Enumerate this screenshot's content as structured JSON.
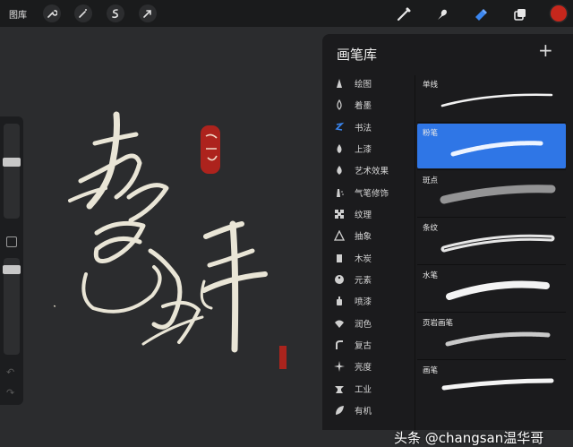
{
  "topbar": {
    "gallery_label": "图库",
    "left_tools": [
      {
        "icon": "wrench-icon"
      },
      {
        "icon": "magic-wand-icon"
      },
      {
        "icon": "selection-icon"
      },
      {
        "icon": "transform-arrow-icon"
      }
    ],
    "right_tools": [
      {
        "icon": "brush-icon",
        "active": false
      },
      {
        "icon": "smudge-icon",
        "active": false
      },
      {
        "icon": "eraser-icon",
        "active": true
      },
      {
        "icon": "layers-icon",
        "active": false
      }
    ],
    "current_color": "#c6271c",
    "accent_color": "#2f76e6"
  },
  "brush_library": {
    "title": "画笔库",
    "add_label": "+",
    "categories": [
      {
        "label": "绘图",
        "icon": "pencil-icon"
      },
      {
        "label": "着墨",
        "icon": "ink-drop-icon"
      },
      {
        "label": "书法",
        "icon": "calligraphy-icon",
        "selected": true
      },
      {
        "label": "上漆",
        "icon": "paint-drop-icon"
      },
      {
        "label": "艺术效果",
        "icon": "flame-icon"
      },
      {
        "label": "气笔修饰",
        "icon": "airbrush-icon"
      },
      {
        "label": "纹理",
        "icon": "checker-icon"
      },
      {
        "label": "抽象",
        "icon": "triangle-icon"
      },
      {
        "label": "木炭",
        "icon": "charcoal-icon"
      },
      {
        "label": "元素",
        "icon": "yin-yang-icon"
      },
      {
        "label": "喷漆",
        "icon": "spray-can-icon"
      },
      {
        "label": "润色",
        "icon": "shell-icon"
      },
      {
        "label": "复古",
        "icon": "retro-icon"
      },
      {
        "label": "亮度",
        "icon": "sparkle-icon"
      },
      {
        "label": "工业",
        "icon": "anvil-icon"
      },
      {
        "label": "有机",
        "icon": "leaf-icon"
      }
    ],
    "brushes": [
      {
        "name": "单线",
        "selected": false
      },
      {
        "name": "粉笔",
        "selected": true
      },
      {
        "name": "斑点",
        "selected": false
      },
      {
        "name": "条纹",
        "selected": false
      },
      {
        "name": "水笔",
        "selected": false
      },
      {
        "name": "页岩画笔",
        "selected": false
      },
      {
        "name": "画笔",
        "selected": false
      }
    ]
  },
  "watermark": "头条 @changsan温华哥"
}
